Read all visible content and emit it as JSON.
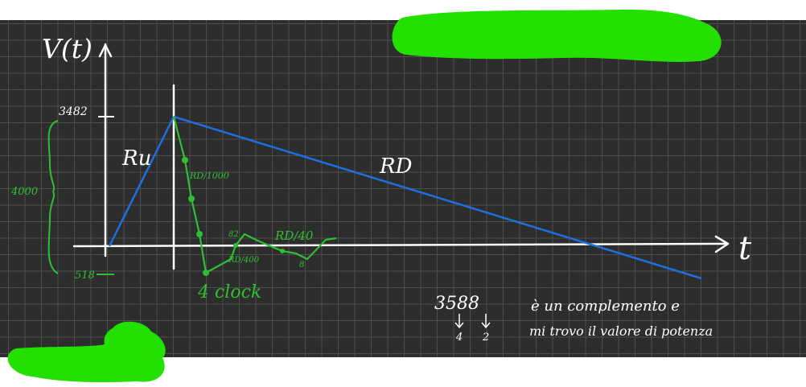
{
  "colors": {
    "board": "#2d2d2d",
    "grid": "#4e4e4e",
    "ink_white": "#ffffff",
    "ink_blue": "#1e6fe0",
    "ink_green": "#2fbf32",
    "redaction": "#22e000"
  },
  "axes": {
    "y_label": "V(t)",
    "x_label": "t"
  },
  "levels": {
    "top": "3482",
    "bottom": "518",
    "span": "4000"
  },
  "curves": {
    "ramp_up_label": "Ru",
    "ramp_down_label": "RD",
    "fast_down_label": "RD/1000",
    "medium_label": "RD/40",
    "slow_label": "RD/400",
    "tick_82": "82",
    "tick_8": "8",
    "clock_note": "4 clock"
  },
  "note": {
    "number": "3588",
    "digit_a": "4",
    "digit_b": "2",
    "line1": "è un complemento e",
    "line2": "mi trovo il valore di potenza"
  }
}
